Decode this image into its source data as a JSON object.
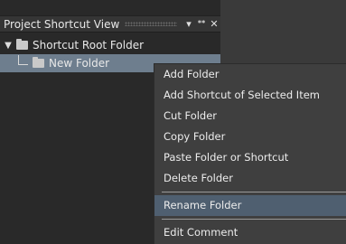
{
  "panel": {
    "title": "Project Shortcut View",
    "pin_icon": "pin-icon",
    "close_icon": "close-icon",
    "menu_icon": "dropdown-arrow-icon",
    "pin_glyph": "▾ ⫴",
    "close_glyph": "✕"
  },
  "tree": {
    "root": {
      "label": "Shortcut Root Folder",
      "expander": "▼"
    },
    "child": {
      "label": "New Folder",
      "selected": true
    }
  },
  "context_menu": {
    "items": [
      "Add Folder",
      "Add Shortcut of Selected Item",
      "Cut Folder",
      "Copy Folder",
      "Paste Folder or Shortcut",
      "Delete Folder",
      "Rename Folder",
      "Edit Comment"
    ],
    "highlighted": "Rename Folder"
  },
  "colors": {
    "pane_bg": "#292929",
    "selection": "#6e7e8e",
    "menu_bg": "#3f3f3f",
    "menu_highlight": "#4f5f70"
  }
}
